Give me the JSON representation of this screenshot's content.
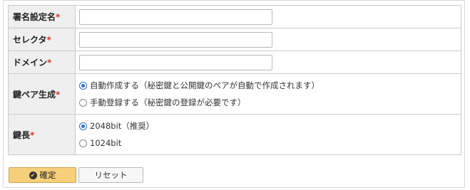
{
  "form": {
    "signature_name": {
      "label": "署名設定名",
      "value": ""
    },
    "selector": {
      "label": "セレクタ",
      "value": ""
    },
    "domain": {
      "label": "ドメイン",
      "value": ""
    },
    "key_pair": {
      "label": "鍵ペア生成",
      "options": [
        {
          "label": "自動作成する（秘密鍵と公開鍵のペアが自動で作成されます）",
          "selected": true
        },
        {
          "label": "手動登録する（秘密鍵の登録が必要です）",
          "selected": false
        }
      ]
    },
    "key_length": {
      "label": "鍵長",
      "options": [
        {
          "label": "2048bit（推奨）",
          "selected": true
        },
        {
          "label": "1024bit",
          "selected": false
        }
      ]
    },
    "required_mark": "*"
  },
  "buttons": {
    "confirm_label": "確定",
    "reset_label": "リセット"
  }
}
